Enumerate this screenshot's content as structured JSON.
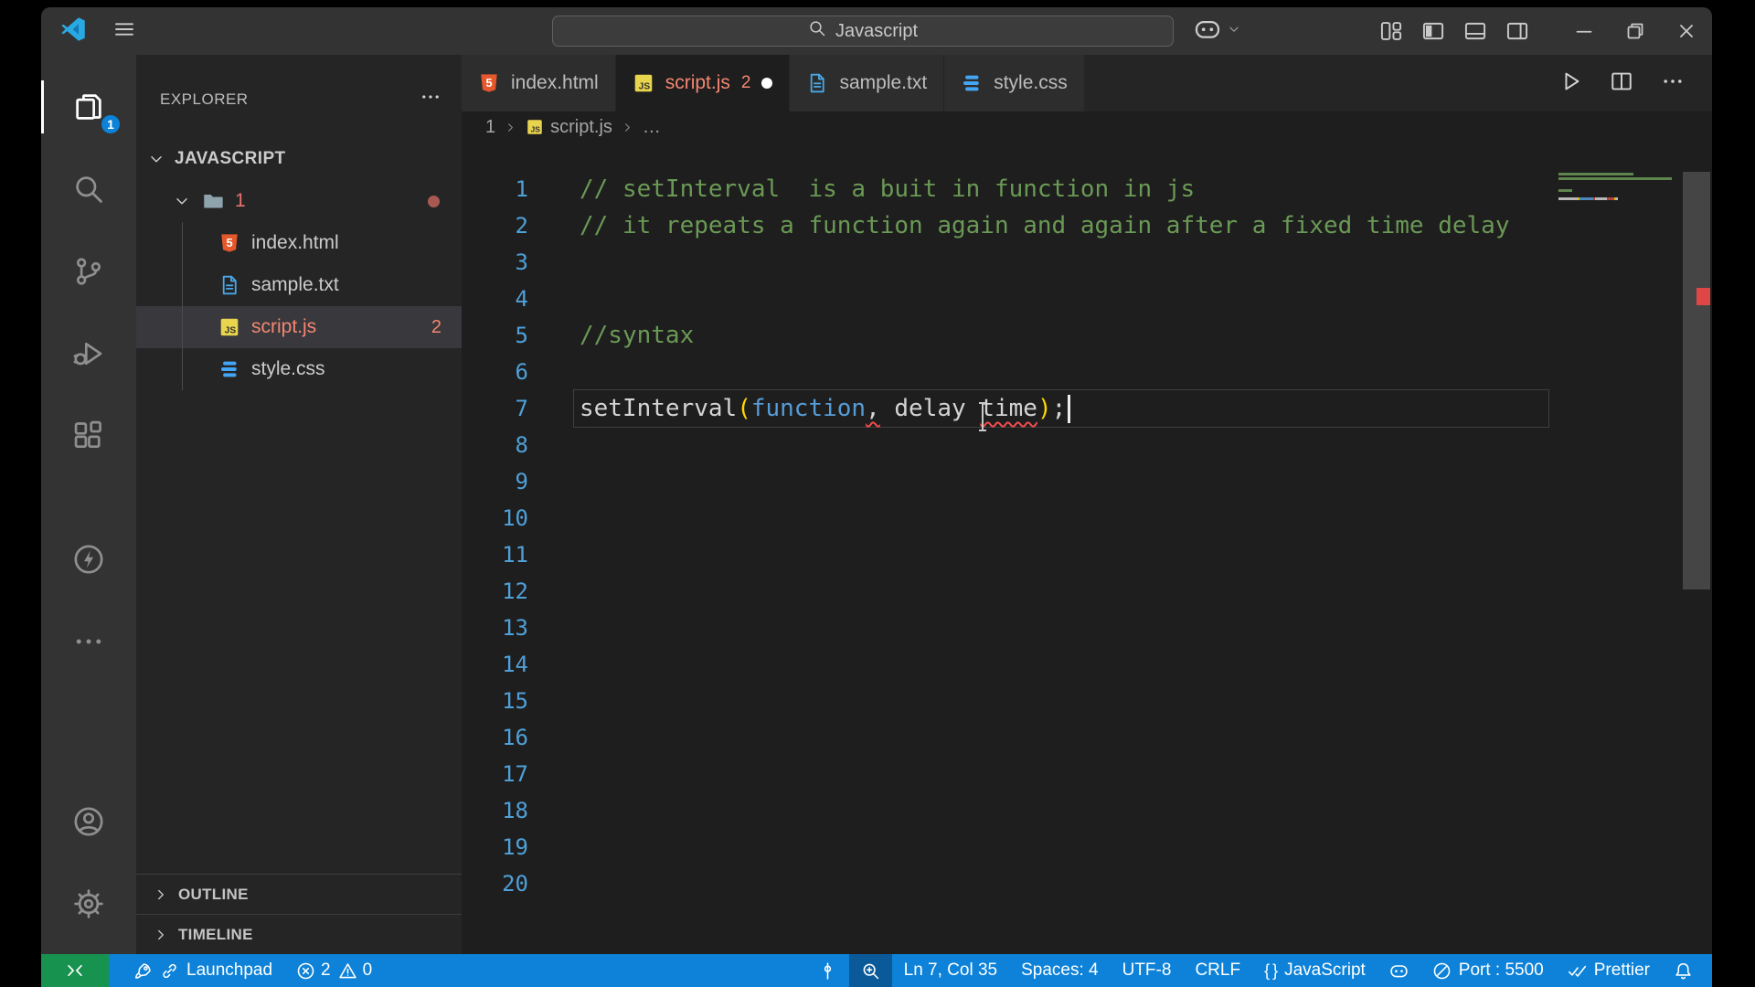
{
  "theme": {
    "accent": "#0d82d8",
    "remote_green": "#17934f",
    "error_red": "#f48771",
    "badge_blue": "#0c82d8",
    "modified_dot": "#ffffff",
    "folder_dot": "#a85a52"
  },
  "titlebar": {
    "logo": "vscode-logo-icon",
    "menu_icon": "menu-icon",
    "nav_icons": [
      "arrow-left-icon",
      "arrow-right-icon"
    ],
    "search": {
      "icon": "search-icon",
      "value": "Javascript"
    },
    "copilot_icon": "copilot-icon",
    "copilot_chevron": "chevron-down-icon",
    "layout_controls": [
      "layout-icon",
      "sidebar-left-icon",
      "panel-icon",
      "sidebar-right-icon"
    ],
    "window_controls": [
      "minimize-icon",
      "restore-icon",
      "close-icon"
    ]
  },
  "activity_bar": {
    "top": [
      {
        "name": "explorer",
        "icon": "files-icon",
        "active": true,
        "badge": "1"
      },
      {
        "name": "search",
        "icon": "search-icon"
      },
      {
        "name": "source-control",
        "icon": "source-control-icon"
      },
      {
        "name": "run-and-debug",
        "icon": "debug-icon"
      },
      {
        "name": "extensions",
        "icon": "extensions-icon"
      }
    ],
    "middle": [
      {
        "name": "live-server",
        "icon": "zap-icon"
      },
      {
        "name": "more-views",
        "icon": "ellipsis-icon"
      }
    ],
    "bottom": [
      {
        "name": "accounts",
        "icon": "account-icon"
      },
      {
        "name": "settings",
        "icon": "gear-icon"
      }
    ]
  },
  "explorer": {
    "title": "EXPLORER",
    "more_icon": "ellipsis-icon",
    "workspace": "JAVASCRIPT",
    "tree": [
      {
        "label": "1",
        "type": "folder",
        "icon": "folder-icon",
        "chevron": "chevron-down-icon",
        "color": "#e9716f",
        "dot": true
      },
      {
        "label": "index.html",
        "type": "file",
        "icon": "html-icon"
      },
      {
        "label": "sample.txt",
        "type": "file",
        "icon": "txt-icon"
      },
      {
        "label": "script.js",
        "type": "file",
        "icon": "js-icon",
        "color": "#f48771",
        "badge": "2",
        "selected": true
      },
      {
        "label": "style.css",
        "type": "file",
        "icon": "css-icon"
      }
    ],
    "sections": [
      {
        "label": "OUTLINE",
        "chevron": "chevron-right-icon"
      },
      {
        "label": "TIMELINE",
        "chevron": "chevron-right-icon"
      }
    ]
  },
  "tabs": [
    {
      "label": "index.html",
      "icon": "html-icon"
    },
    {
      "label": "script.js",
      "icon": "js-icon",
      "badge": "2",
      "modified": true,
      "active": true,
      "color": "#f48771"
    },
    {
      "label": "sample.txt",
      "icon": "txt-icon"
    },
    {
      "label": "style.css",
      "icon": "css-icon"
    }
  ],
  "editor_actions": [
    {
      "name": "run-file",
      "icon": "run-icon"
    },
    {
      "name": "split-editor",
      "icon": "split-editor-icon"
    },
    {
      "name": "more-actions",
      "icon": "ellipsis-icon"
    }
  ],
  "breadcrumb": [
    {
      "label": "1"
    },
    {
      "label": "script.js",
      "icon": "js-icon"
    },
    {
      "label": "…"
    }
  ],
  "editor": {
    "total_lines": 20,
    "cursor": {
      "line": 7,
      "col": 35
    },
    "lines": {
      "1": [
        {
          "text": "// setInterval  is a buit in function in js",
          "type": "comment"
        }
      ],
      "2": [
        {
          "text": "// it repeats a function again and again after a fixed time delay",
          "type": "comment"
        }
      ],
      "5": [
        {
          "text": "//syntax",
          "type": "comment"
        }
      ],
      "7": [
        {
          "text": "setInterval",
          "type": "plain"
        },
        {
          "text": "(",
          "type": "bracket"
        },
        {
          "text": "function",
          "type": "keyword"
        },
        {
          "text": ",",
          "type": "plain",
          "error": true
        },
        {
          "text": " delay ",
          "type": "plain"
        },
        {
          "text": "time",
          "type": "plain",
          "error": true
        },
        {
          "text": ")",
          "type": "bracket"
        },
        {
          "text": ";",
          "type": "plain"
        }
      ]
    },
    "colors": {
      "comment": "#6a9955",
      "keyword": "#569cd6",
      "bracket": "#ffd700",
      "plain": "#d4d4d4",
      "line_number": "#4fa0d8",
      "squiggle": "#f14c4c"
    }
  },
  "status_bar": {
    "remote": {
      "icon": "remote-icon"
    },
    "left": [
      {
        "name": "launchpad",
        "icons": [
          "rocket-icon",
          "link-icon"
        ],
        "label": "Launchpad"
      },
      {
        "name": "problems",
        "parts": [
          {
            "icon": "error-circle-icon",
            "label": "2"
          },
          {
            "icon": "warning-icon",
            "label": "0"
          }
        ]
      }
    ],
    "right": [
      {
        "name": "caret-indicator",
        "icon": "caret-icon"
      },
      {
        "name": "zoom",
        "icon": "zoom-in-icon",
        "emphasis": true
      },
      {
        "name": "cursor-position",
        "label": "Ln 7, Col 35"
      },
      {
        "name": "indentation",
        "label": "Spaces: 4"
      },
      {
        "name": "encoding",
        "label": "UTF-8"
      },
      {
        "name": "end-of-line",
        "label": "CRLF"
      },
      {
        "name": "language-mode",
        "label": "JavaScript",
        "text_icon": "{ }"
      },
      {
        "name": "copilot",
        "icon": "copilot-icon"
      },
      {
        "name": "live-server-port",
        "icon": "circle-slash-icon",
        "label": "Port : 5500"
      },
      {
        "name": "formatter",
        "icon": "double-check-icon",
        "label": "Prettier"
      },
      {
        "name": "notifications",
        "icon": "bell-icon"
      }
    ]
  }
}
